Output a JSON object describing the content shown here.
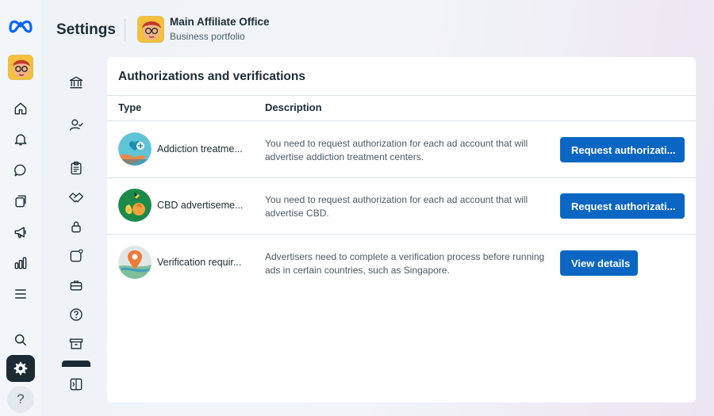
{
  "app": {
    "page_title": "Settings",
    "brand_color": "#0a66c2"
  },
  "portfolio": {
    "name": "Main Affiliate Office",
    "subtitle": "Business portfolio"
  },
  "rail": {
    "icons": [
      "meta-logo-icon",
      "home-icon",
      "bell-icon",
      "chat-icon",
      "pages-icon",
      "megaphone-icon",
      "bar-chart-icon",
      "menu-icon",
      "search-icon",
      "settings-gear-icon"
    ],
    "help_label": "?"
  },
  "subnav": {
    "icons": [
      "bank-icon",
      "person-check-icon",
      "clipboard-icon",
      "handshake-icon",
      "lock-icon",
      "square-badge-icon",
      "briefcase-icon",
      "help-circle-icon",
      "archive-icon",
      "sidebar-toggle-icon"
    ]
  },
  "card": {
    "title": "Authorizations and verifications",
    "columns": {
      "type": "Type",
      "description": "Description"
    },
    "rows": [
      {
        "icon": "heart-hand-icon",
        "type": "Addiction treatme...",
        "description": "You need to request authorization for each ad account that will advertise addiction treatment centers.",
        "action": "Request authorizati..."
      },
      {
        "icon": "cbd-leaf-icon",
        "type": "CBD advertiseme...",
        "description": "You need to request authorization for each ad account that will advertise CBD.",
        "action": "Request authorizati..."
      },
      {
        "icon": "map-pin-icon",
        "type": "Verification requir...",
        "description": "Advertisers need to complete a verification process before running ads in certain countries, such as Singapore.",
        "action": "View details"
      }
    ]
  }
}
